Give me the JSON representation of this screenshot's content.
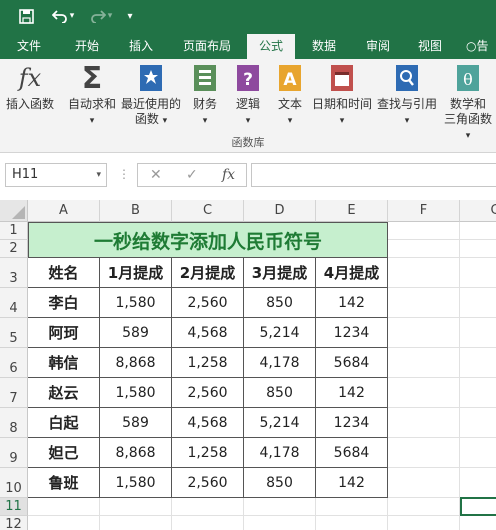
{
  "qat": {
    "undo_arrow": "▾",
    "customize": "▾"
  },
  "tabs": [
    "文件",
    "开始",
    "插入",
    "页面布局",
    "公式",
    "数据",
    "审阅",
    "视图",
    "告"
  ],
  "ribbon": {
    "buttons": [
      "插入函数",
      "自动求和",
      "最近使用的",
      "函数",
      "财务",
      "逻辑",
      "文本",
      "日期和时间",
      "查找与引用",
      "数学和",
      "三角函数"
    ],
    "group_label": "函数库",
    "fx_glyph": "fx",
    "sum_glyph": "Σ"
  },
  "formula_bar": {
    "name_box": "H11",
    "cancel": "✕",
    "enter": "✓",
    "fx": "fx",
    "value": ""
  },
  "columns": [
    "A",
    "B",
    "C",
    "D",
    "E",
    "F",
    "G"
  ],
  "rows": [
    "1",
    "2",
    "3",
    "4",
    "5",
    "6",
    "7",
    "8",
    "9",
    "10",
    "11",
    "12"
  ],
  "sheet": {
    "title": "一秒给数字添加人民币符号",
    "header": [
      "姓名",
      "1月提成",
      "2月提成",
      "3月提成",
      "4月提成"
    ],
    "data": [
      [
        "李白",
        "1,580",
        "2,560",
        "850",
        "142"
      ],
      [
        "阿珂",
        "589",
        "4,568",
        "5,214",
        "1234"
      ],
      [
        "韩信",
        "8,868",
        "1,258",
        "4,178",
        "5684"
      ],
      [
        "赵云",
        "1,580",
        "2,560",
        "850",
        "142"
      ],
      [
        "白起",
        "589",
        "4,568",
        "5,214",
        "1234"
      ],
      [
        "妲己",
        "8,868",
        "1,258",
        "4,178",
        "5684"
      ],
      [
        "鲁班",
        "1,580",
        "2,560",
        "850",
        "142"
      ]
    ]
  },
  "colors": {
    "brand": "#217346",
    "title_fill": "#c6efce",
    "title_text": "#1e7b34"
  }
}
